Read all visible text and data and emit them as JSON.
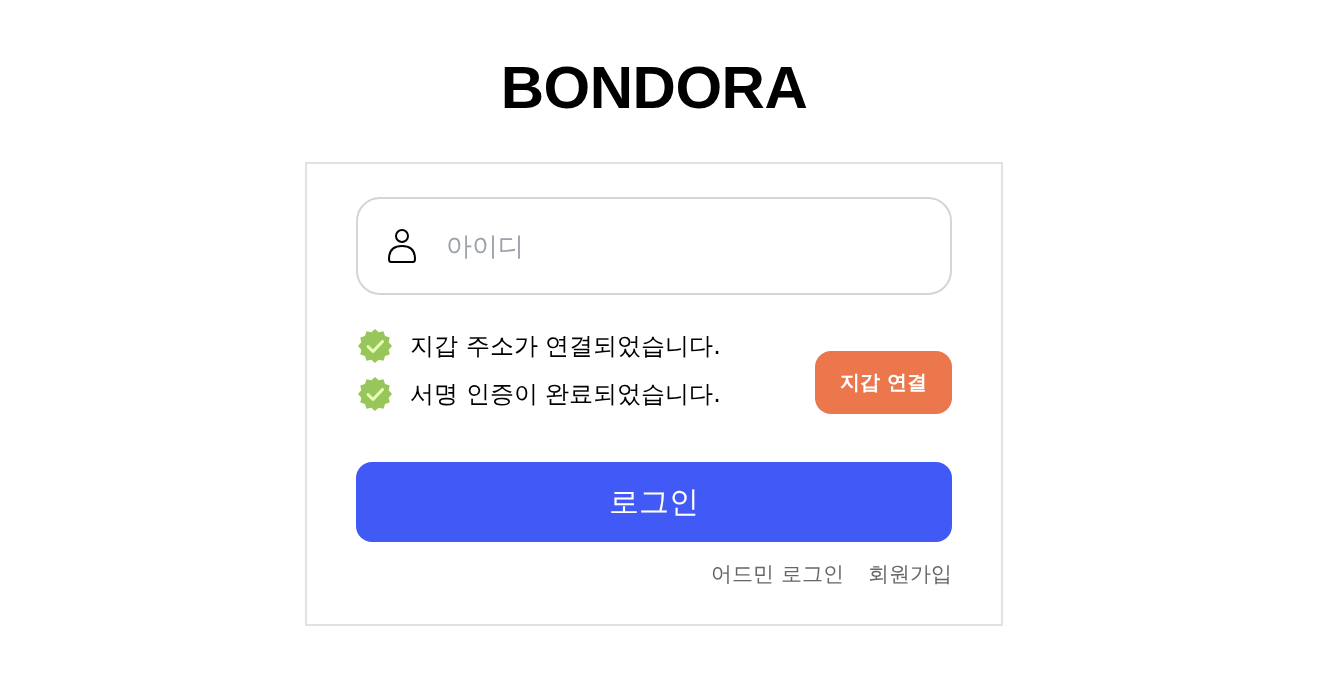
{
  "logo": {
    "text": "BONDORA"
  },
  "login_form": {
    "id_field": {
      "placeholder": "아이디"
    },
    "status_messages": [
      {
        "text": "지갑 주소가 연결되었습니다.",
        "verified": true
      },
      {
        "text": "서명 인증이 완료되었습니다.",
        "verified": true
      }
    ],
    "wallet_button": "지갑 연결",
    "login_button": "로그인",
    "links": [
      "어드민 로그인",
      "회원가입"
    ]
  }
}
